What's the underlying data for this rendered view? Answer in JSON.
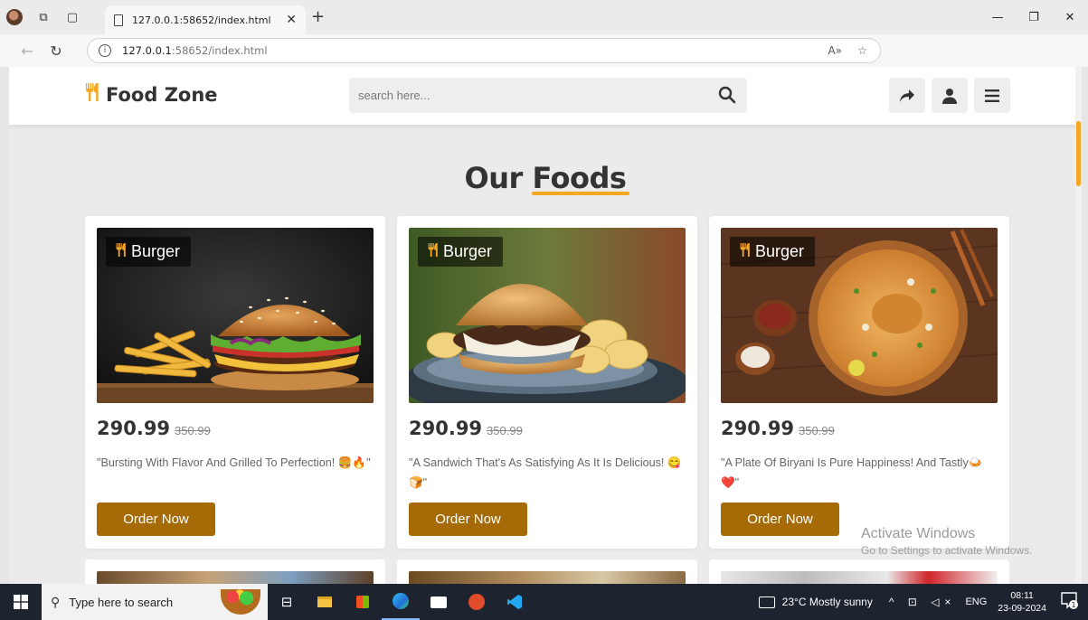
{
  "browser": {
    "tab_title": "127.0.0.1:58652/index.html",
    "url_host": "127.0.0.1",
    "url_path": ":58652/index.html"
  },
  "site": {
    "logo_text": "Food Zone",
    "search_placeholder": "search here..."
  },
  "section": {
    "title_first": "Our",
    "title_accent": "Foods"
  },
  "foods": [
    {
      "category": "Burger",
      "price": "290.99",
      "old_price": "350.99",
      "description": "\"Bursting With Flavor And Grilled To Perfection! 🍔🔥\"",
      "button": "Order Now"
    },
    {
      "category": "Burger",
      "price": "290.99",
      "old_price": "350.99",
      "description": "\"A Sandwich That's As Satisfying As It Is Delicious! 😋🍞\"",
      "button": "Order Now"
    },
    {
      "category": "Burger",
      "price": "290.99",
      "old_price": "350.99",
      "description": "\"A Plate Of Biryani Is Pure Happiness! And Tastly🍛❤️\"",
      "button": "Order Now"
    }
  ],
  "watermark": {
    "line1": "Activate Windows",
    "line2": "Go to Settings to activate Windows."
  },
  "taskbar": {
    "search_text": "Type here to search",
    "weather": "23°C  Mostly sunny",
    "language": "ENG",
    "time": "08:11",
    "date": "23-09-2024"
  },
  "colors": {
    "accent": "#f5a623",
    "button": "#a66b07",
    "page_bg": "#ebebeb"
  }
}
